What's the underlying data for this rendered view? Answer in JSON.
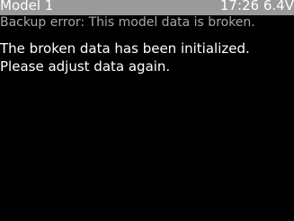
{
  "header": {
    "model_name": "Model 1",
    "clock": "17:26",
    "voltage": "6.4V"
  },
  "error": {
    "title": "Backup error: This model data is broken."
  },
  "message": {
    "lines": [
      "The broken data has been initialized.",
      "Please adjust data again."
    ]
  },
  "colors": {
    "screen_background": "#000000",
    "status_bar": "#9a9a9a",
    "error_title_text": "#a8a8a8",
    "message_text": "#ffffff"
  }
}
